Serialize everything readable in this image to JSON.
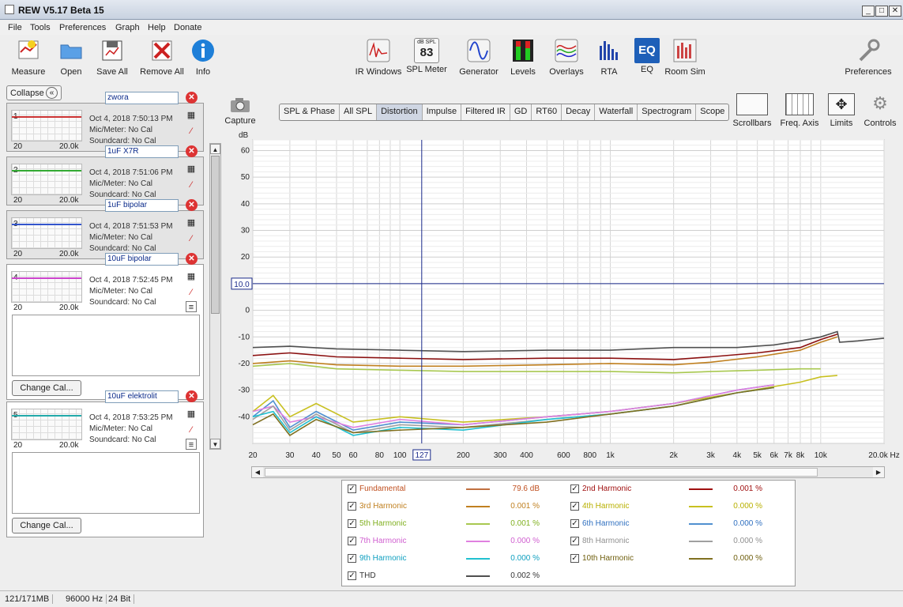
{
  "window": {
    "title": "REW V5.17 Beta 15"
  },
  "menu": [
    "File",
    "Tools",
    "Preferences",
    "Graph",
    "Help",
    "Donate"
  ],
  "toolbar_left": [
    {
      "label": "Measure",
      "icon": "measure-icon"
    },
    {
      "label": "Open",
      "icon": "folder-icon"
    },
    {
      "label": "Save All",
      "icon": "save-icon"
    },
    {
      "label": "Remove All",
      "icon": "remove-icon"
    },
    {
      "label": "Info",
      "icon": "info-icon"
    }
  ],
  "toolbar_center": [
    {
      "label": "IR Windows",
      "icon": "ir-windows-icon"
    },
    {
      "label": "SPL Meter",
      "icon": "spl-meter-icon",
      "badge_top": "dB SPL",
      "badge_value": "83"
    },
    {
      "label": "Generator",
      "icon": "generator-icon"
    },
    {
      "label": "Levels",
      "icon": "levels-icon"
    },
    {
      "label": "Overlays",
      "icon": "overlays-icon"
    },
    {
      "label": "RTA",
      "icon": "rta-icon"
    },
    {
      "label": "EQ",
      "icon": "eq-icon",
      "badge_value": "EQ"
    },
    {
      "label": "Room Sim",
      "icon": "room-sim-icon"
    }
  ],
  "toolbar_right": {
    "label": "Preferences",
    "icon": "wrench-icon"
  },
  "left_panel": {
    "collapse_label": "Collapse",
    "measurements": [
      {
        "num": "1",
        "name": "zwora",
        "date": "Oct 4, 2018 7:50:13 PM",
        "mic": "Mic/Meter: No Cal",
        "card": "Soundcard: No Cal",
        "color": "#cc3333",
        "x0": "20",
        "x1": "20.0k"
      },
      {
        "num": "2",
        "name": "1uF X7R",
        "date": "Oct 4, 2018 7:51:06 PM",
        "mic": "Mic/Meter: No Cal",
        "card": "Soundcard: No Cal",
        "color": "#33aa33",
        "x0": "20",
        "x1": "20.0k"
      },
      {
        "num": "3",
        "name": "1uF bipolar",
        "date": "Oct 4, 2018 7:51:53 PM",
        "mic": "Mic/Meter: No Cal",
        "card": "Soundcard: No Cal",
        "color": "#3355cc",
        "x0": "20",
        "x1": "20.0k"
      },
      {
        "num": "4",
        "name": "10uF bipolar",
        "date": "Oct 4, 2018 7:52:45 PM",
        "mic": "Mic/Meter: No Cal",
        "card": "Soundcard: No Cal",
        "color": "#cc44cc",
        "x0": "20",
        "x1": "20.0k"
      },
      {
        "num": "5",
        "name": "10uF elektrolit",
        "date": "Oct 4, 2018 7:53:25 PM",
        "mic": "Mic/Meter: No Cal",
        "card": "Soundcard: No Cal",
        "color": "#22aaaa",
        "x0": "20",
        "x1": "20.0k"
      }
    ],
    "change_cal_label": "Change Cal..."
  },
  "capture_label": "Capture",
  "tabs": [
    "SPL & Phase",
    "All SPL",
    "Distortion",
    "Impulse",
    "Filtered IR",
    "GD",
    "RT60",
    "Decay",
    "Waterfall",
    "Spectrogram",
    "Scope"
  ],
  "active_tab": "Distortion",
  "right_tools": [
    {
      "label": "Scrollbars",
      "icon": "scrollbars-icon"
    },
    {
      "label": "Freq. Axis",
      "icon": "freq-axis-icon"
    },
    {
      "label": "Limits",
      "icon": "limits-icon"
    },
    {
      "label": "Controls",
      "icon": "gear-icon"
    }
  ],
  "chart_data": {
    "type": "line",
    "ylabel": "dB",
    "xlabel": "Hz",
    "x_scale": "log",
    "xlim": [
      20,
      20000
    ],
    "ylim": [
      -50,
      64
    ],
    "y_ticks": [
      60,
      50,
      40,
      30,
      20,
      10,
      0,
      -10,
      -20,
      -30,
      -40
    ],
    "x_tick_labels": [
      "20",
      "30",
      "40",
      "50",
      "60",
      "80",
      "100",
      "200",
      "300",
      "400",
      "600",
      "800",
      "1k",
      "2k",
      "3k",
      "4k",
      "5k",
      "6k",
      "7k",
      "8k",
      "10k",
      "20.0k Hz"
    ],
    "cursor": {
      "x_label": "127",
      "y_label": "10.0"
    },
    "series": [
      {
        "name": "THD",
        "color": "#505050",
        "x": [
          20,
          30,
          50,
          100,
          200,
          500,
          1000,
          2000,
          4000,
          6000,
          8000,
          10000,
          12000,
          12300,
          15000,
          20000
        ],
        "y": [
          -14,
          -13.5,
          -14.5,
          -15,
          -15.5,
          -15,
          -15,
          -14,
          -14,
          -13,
          -11.5,
          -10,
          -8,
          -12,
          -11.5,
          -10.5
        ]
      },
      {
        "name": "2nd Harmonic",
        "color": "#8b1010",
        "x": [
          20,
          30,
          50,
          100,
          200,
          500,
          1000,
          2000,
          3000,
          5000,
          8000,
          10000,
          12000
        ],
        "y": [
          -17,
          -16,
          -17.5,
          -18,
          -18.5,
          -18,
          -18,
          -18.5,
          -17.5,
          -16,
          -14,
          -11,
          -9
        ]
      },
      {
        "name": "3rd Harmonic",
        "color": "#c08020",
        "x": [
          20,
          30,
          50,
          100,
          200,
          500,
          1000,
          2000,
          3000,
          5000,
          8000,
          10000,
          12000
        ],
        "y": [
          -20,
          -19,
          -20.5,
          -21,
          -21,
          -20.5,
          -20,
          -20.5,
          -19.5,
          -17.5,
          -15,
          -12,
          -10
        ]
      },
      {
        "name": "5th Harmonic",
        "color": "#a8c850",
        "x": [
          20,
          30,
          50,
          100,
          200,
          500,
          1000,
          2000,
          3000,
          5000,
          8000,
          10000
        ],
        "y": [
          -21,
          -20,
          -22,
          -22.5,
          -23,
          -23,
          -23,
          -23.5,
          -23,
          -22.5,
          -22,
          -22
        ]
      },
      {
        "name": "4th Harmonic",
        "color": "#c8c020",
        "x": [
          20,
          25,
          30,
          40,
          60,
          100,
          200,
          500,
          1000,
          2000,
          4000,
          8000,
          10000,
          12000
        ],
        "y": [
          -38,
          -32,
          -40,
          -35,
          -42,
          -40,
          -42,
          -40,
          -38,
          -35,
          -31,
          -27,
          -25,
          -24.5
        ]
      },
      {
        "name": "6th Harmonic",
        "color": "#5090d0",
        "x": [
          20,
          25,
          30,
          40,
          60,
          100,
          200,
          500,
          1000,
          2000,
          4000,
          6000
        ],
        "y": [
          -40,
          -34,
          -44,
          -38,
          -45,
          -42,
          -43,
          -40,
          -38,
          -35,
          -30,
          -28
        ]
      },
      {
        "name": "7th Harmonic",
        "color": "#e080e0",
        "x": [
          20,
          25,
          30,
          40,
          60,
          100,
          200,
          500,
          1000,
          2000,
          4000,
          6000
        ],
        "y": [
          -38,
          -36,
          -42,
          -40,
          -44,
          -41,
          -43,
          -40,
          -38,
          -35,
          -30,
          -28
        ]
      },
      {
        "name": "8th Harmonic",
        "color": "#a0a0a0",
        "x": [
          20,
          25,
          30,
          40,
          60,
          100,
          200,
          500,
          1000,
          2000,
          4000,
          6000
        ],
        "y": [
          -41,
          -36,
          -45,
          -39,
          -46,
          -43,
          -44,
          -41,
          -39,
          -36,
          -31,
          -29
        ]
      },
      {
        "name": "9th Harmonic",
        "color": "#20c0d0",
        "x": [
          20,
          25,
          30,
          40,
          60,
          100,
          200,
          500,
          1000,
          2000,
          4000,
          6000
        ],
        "y": [
          -40,
          -38,
          -46,
          -40,
          -47,
          -44,
          -45,
          -41,
          -39,
          -36,
          -31,
          -29
        ]
      },
      {
        "name": "10th Harmonic",
        "color": "#807020",
        "x": [
          20,
          25,
          30,
          40,
          60,
          100,
          200,
          500,
          1000,
          2000,
          4000,
          6000
        ],
        "y": [
          -43,
          -39,
          -47,
          -41,
          -46,
          -45,
          -44,
          -42,
          -39,
          -36,
          -31,
          -29
        ]
      }
    ]
  },
  "legend": [
    {
      "name": "Fundamental",
      "value": "79.6 dB",
      "color": "#c07040",
      "text_color": "#c05020"
    },
    {
      "name": "2nd Harmonic",
      "value": "0.001 %",
      "color": "#a01010",
      "text_color": "#a01010"
    },
    {
      "name": "3rd Harmonic",
      "value": "0.001 %",
      "color": "#c08020",
      "text_color": "#c08020"
    },
    {
      "name": "4th Harmonic",
      "value": "0.000 %",
      "color": "#c8c020",
      "text_color": "#b8b000"
    },
    {
      "name": "5th Harmonic",
      "value": "0.001 %",
      "color": "#a8c850",
      "text_color": "#80b020"
    },
    {
      "name": "6th Harmonic",
      "value": "0.000 %",
      "color": "#5090d0",
      "text_color": "#3070c0"
    },
    {
      "name": "7th Harmonic",
      "value": "0.000 %",
      "color": "#e080e0",
      "text_color": "#d060d0"
    },
    {
      "name": "8th Harmonic",
      "value": "0.000 %",
      "color": "#a0a0a0",
      "text_color": "#909090"
    },
    {
      "name": "9th Harmonic",
      "value": "0.000 %",
      "color": "#20c0d0",
      "text_color": "#10a0c0"
    },
    {
      "name": "10th Harmonic",
      "value": "0.000 %",
      "color": "#807020",
      "text_color": "#706010"
    },
    {
      "name": "THD",
      "value": "0.002 %",
      "color": "#505050",
      "text_color": "#333333"
    }
  ],
  "status": {
    "memory": "121/171MB",
    "rate": "96000 Hz",
    "bits": "24 Bit"
  }
}
